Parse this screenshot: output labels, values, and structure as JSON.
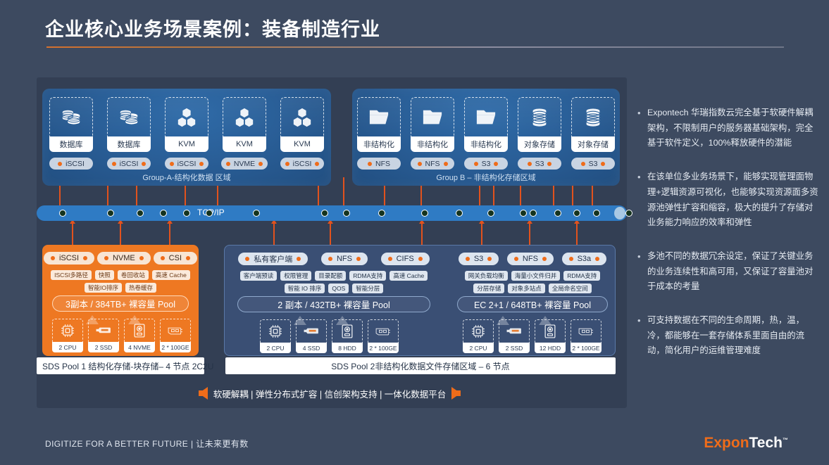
{
  "slide": {
    "title": "企业核心业务场景案例：装备制造行业",
    "background_color": "#3d4a60",
    "accent_color": "#ef6c1a"
  },
  "group_a": {
    "label": "Group-A-结构化数据 区域",
    "nodes": [
      {
        "name": "数据库",
        "icon": "database-icon",
        "protocol": "iSCSI",
        "dots": "left"
      },
      {
        "name": "数据库",
        "icon": "database-icon",
        "protocol": "iSCSI",
        "dots": "both"
      },
      {
        "name": "KVM",
        "icon": "kvm-cubes-icon",
        "protocol": "iSCSI",
        "dots": "both"
      },
      {
        "name": "KVM",
        "icon": "kvm-cubes-icon",
        "protocol": "NVME",
        "dots": "both"
      },
      {
        "name": "KVM",
        "icon": "kvm-cubes-icon",
        "protocol": "iSCSI",
        "dots": "both"
      }
    ]
  },
  "group_b": {
    "label": "Group B – 非结构化存储区域",
    "nodes": [
      {
        "name": "非结构化",
        "icon": "folder-icon",
        "protocol": "NFS",
        "dots": "left"
      },
      {
        "name": "非结构化",
        "icon": "folder-icon",
        "protocol": "NFS",
        "dots": "both"
      },
      {
        "name": "非结构化",
        "icon": "folder-icon",
        "protocol": "S3",
        "dots": "both"
      },
      {
        "name": "对象存储",
        "icon": "disk-stack-icon",
        "protocol": "S3",
        "dots": "both"
      },
      {
        "name": "对象存储",
        "icon": "disk-stack-icon",
        "protocol": "S3",
        "dots": "both"
      }
    ]
  },
  "network": {
    "label": "TCP/IP",
    "hub_positions": [
      32,
      100,
      142,
      175,
      208,
      240,
      307,
      404,
      435,
      485,
      546,
      595,
      640,
      686,
      700,
      735,
      762,
      790,
      836
    ]
  },
  "pool1": {
    "protocols": [
      "iSCSI",
      "NVME",
      "CSI"
    ],
    "tags": [
      "ISCSI多路径",
      "快照",
      "卷回收站",
      "高速 Cache",
      "智能IO排序",
      "热卷缓存"
    ],
    "capacity": "3副本 / 384TB+ 裸容量  Pool",
    "hardware": [
      {
        "label": "2 CPU",
        "icon": "cpu-icon"
      },
      {
        "label": "2 SSD",
        "icon": "ssd-card-icon"
      },
      {
        "label": "4 NVME",
        "icon": "nvme-drive-icon"
      },
      {
        "label": "2 * 100GE",
        "icon": "nic-card-icon"
      }
    ],
    "caption": "SDS Pool 1 结构化存储-块存储– 4 节点 2C2U",
    "color": "#ee7822"
  },
  "pool2": {
    "protocols_left": [
      "私有客户端",
      "NFS",
      "CIFS"
    ],
    "protocols_right": [
      "S3",
      "NFS",
      "S3a"
    ],
    "tags_left": [
      "客户端预读",
      "权限管理",
      "目录配额",
      "RDMA支持",
      "高速 Cache",
      "智能 IO 排序",
      "QOS",
      "智能分层"
    ],
    "tags_right": [
      "网关负载均衡",
      "海量小文件归并",
      "RDMA支持",
      "分层存储",
      "对象多站点",
      "全局命名空间"
    ],
    "capacity_left": "2 副本 / 432TB+ 裸容量  Pool",
    "capacity_right": "EC 2+1 / 648TB+ 裸容量  Pool",
    "hardware_left": [
      {
        "label": "2 CPU",
        "icon": "cpu-icon"
      },
      {
        "label": "4 SSD",
        "icon": "ssd-card-icon"
      },
      {
        "label": "8 HDD",
        "icon": "hdd-icon"
      },
      {
        "label": "2 * 100GE",
        "icon": "nic-card-icon"
      }
    ],
    "hardware_right": [
      {
        "label": "2 CPU",
        "icon": "cpu-icon"
      },
      {
        "label": "2 SSD",
        "icon": "ssd-card-icon"
      },
      {
        "label": "12 HDD",
        "icon": "hdd-icon"
      },
      {
        "label": "2 * 100GE",
        "icon": "nic-card-icon"
      }
    ],
    "caption": "SDS Pool 2非结构化数据文件存储区域 – 6 节点",
    "color": "#3a4f74"
  },
  "banner": {
    "text": "软硬解耦 | 弹性分布式扩容 | 信创架构支持 | 一体化数据平台",
    "left_arrow": "arrow-left-icon",
    "right_arrow": "arrow-right-icon"
  },
  "bullets": [
    "Expontech 华瑞指数云完全基于软硬件解耦架构，不限制用户的服务器基础架构，完全基于软件定义，100%释放硬件的潜能",
    "在该单位多业务场景下，能够实现管理面物理+逻辑资源可视化，也能够实现资源面多资源池弹性扩容和缩容，极大的提升了存储对业务能力响应的效率和弹性",
    "多池不同的数据冗余设定，保证了关键业务的业务连续性和高可用，又保证了容量池对于成本的考量",
    "可支持数据在不同的生命周期，热，温，冷，都能够在一套存储体系里面自由的流动，简化用户的运维管理难度"
  ],
  "footer": {
    "tagline": "DIGITIZE FOR A BETTER FUTURE | 让未来更有数",
    "logo_part1": "Expon",
    "logo_part2": "Tech",
    "logo_tm": "™"
  }
}
